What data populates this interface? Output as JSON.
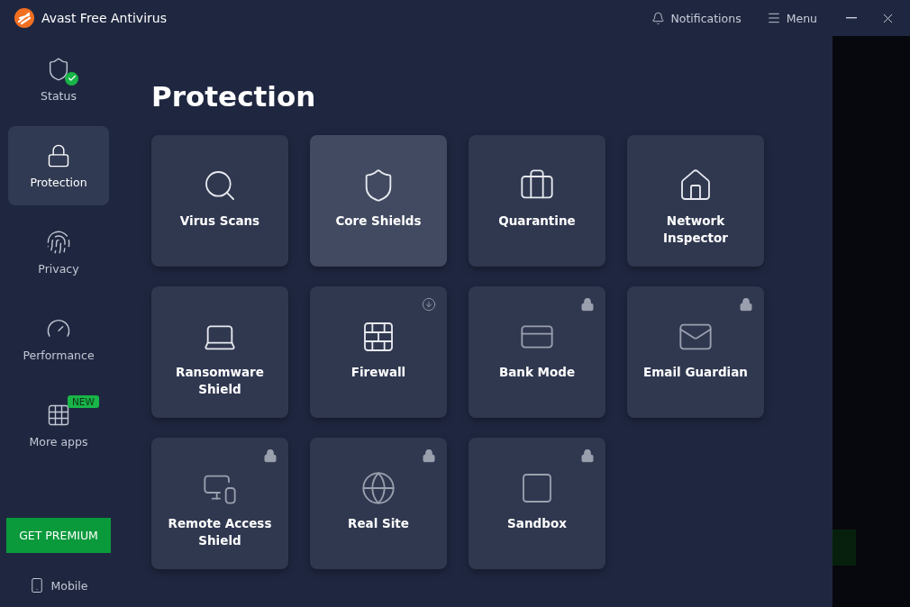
{
  "window": {
    "title": "Avast Free Antivirus",
    "notifications": "Notifications",
    "menu": "Menu"
  },
  "sidebar": {
    "items": [
      {
        "label": "Status",
        "selected": false
      },
      {
        "label": "Protection",
        "selected": true
      },
      {
        "label": "Privacy",
        "selected": false
      },
      {
        "label": "Performance",
        "selected": false
      },
      {
        "label": "More apps",
        "selected": false,
        "badge": "NEW"
      }
    ],
    "premium_button": "GET PREMIUM",
    "mobile": "Mobile"
  },
  "page": {
    "title": "Protection",
    "tiles": [
      {
        "label": "Virus Scans",
        "hovered": false,
        "locked": false,
        "download_available": false
      },
      {
        "label": "Core Shields",
        "hovered": true,
        "locked": false,
        "download_available": false
      },
      {
        "label": "Quarantine",
        "hovered": false,
        "locked": false,
        "download_available": false
      },
      {
        "label": "Network Inspector",
        "hovered": false,
        "locked": false,
        "download_available": false
      },
      {
        "label": "Ransomware Shield",
        "hovered": false,
        "locked": false,
        "download_available": false
      },
      {
        "label": "Firewall",
        "hovered": false,
        "locked": false,
        "download_available": true
      },
      {
        "label": "Bank Mode",
        "hovered": false,
        "locked": true,
        "download_available": false
      },
      {
        "label": "Email Guardian",
        "hovered": false,
        "locked": true,
        "download_available": false
      },
      {
        "label": "Remote Access Shield",
        "hovered": false,
        "locked": true,
        "download_available": false
      },
      {
        "label": "Real Site",
        "hovered": false,
        "locked": true,
        "download_available": false
      },
      {
        "label": "Sandbox",
        "hovered": false,
        "locked": true,
        "download_available": false
      }
    ]
  }
}
